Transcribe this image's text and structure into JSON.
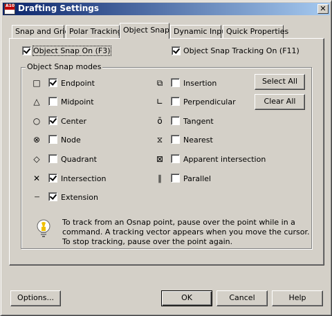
{
  "window": {
    "title": "Drafting Settings",
    "close_glyph": "✕",
    "app_icon_text": "A10"
  },
  "tabs": [
    {
      "label": "Snap and Grid",
      "active": false
    },
    {
      "label": "Polar Tracking",
      "active": false
    },
    {
      "label": "Object Snap",
      "active": true
    },
    {
      "label": "Dynamic Input",
      "active": false
    },
    {
      "label": "Quick Properties",
      "active": false
    }
  ],
  "options": {
    "osnap_on": {
      "label": "Object Snap On (F3)",
      "checked": true
    },
    "osnap_tracking_on": {
      "label": "Object Snap Tracking On (F11)",
      "checked": true
    }
  },
  "modes": {
    "group_title": "Object Snap modes",
    "left": [
      {
        "label": "Endpoint",
        "checked": true,
        "icon": "square-icon",
        "glyph": "□"
      },
      {
        "label": "Midpoint",
        "checked": false,
        "icon": "triangle-icon",
        "glyph": "△"
      },
      {
        "label": "Center",
        "checked": true,
        "icon": "circle-icon",
        "glyph": "○"
      },
      {
        "label": "Node",
        "checked": false,
        "icon": "node-icon",
        "glyph": "⊗"
      },
      {
        "label": "Quadrant",
        "checked": false,
        "icon": "diamond-icon",
        "glyph": "◇"
      },
      {
        "label": "Intersection",
        "checked": true,
        "icon": "x-icon",
        "glyph": "✕"
      },
      {
        "label": "Extension",
        "checked": true,
        "icon": "extension-icon",
        "glyph": "---"
      }
    ],
    "right": [
      {
        "label": "Insertion",
        "checked": false,
        "icon": "insertion-icon",
        "glyph": "⧉"
      },
      {
        "label": "Perpendicular",
        "checked": false,
        "icon": "perpendicular-icon",
        "glyph": "∟"
      },
      {
        "label": "Tangent",
        "checked": false,
        "icon": "tangent-icon",
        "glyph": "ō"
      },
      {
        "label": "Nearest",
        "checked": false,
        "icon": "nearest-icon",
        "glyph": "⧖"
      },
      {
        "label": "Apparent intersection",
        "checked": false,
        "icon": "apparent-intersection-icon",
        "glyph": "⊠"
      },
      {
        "label": "Parallel",
        "checked": false,
        "icon": "parallel-icon",
        "glyph": "∥"
      }
    ]
  },
  "buttons": {
    "select_all": "Select All",
    "clear_all": "Clear All",
    "options": "Options...",
    "ok": "OK",
    "cancel": "Cancel",
    "help": "Help"
  },
  "info": {
    "icon": "lightbulb-icon",
    "lines": [
      "To track from an Osnap point, pause over the point while in a",
      "command.  A tracking vector appears when you move the cursor.",
      "To stop tracking, pause over the point again."
    ]
  }
}
